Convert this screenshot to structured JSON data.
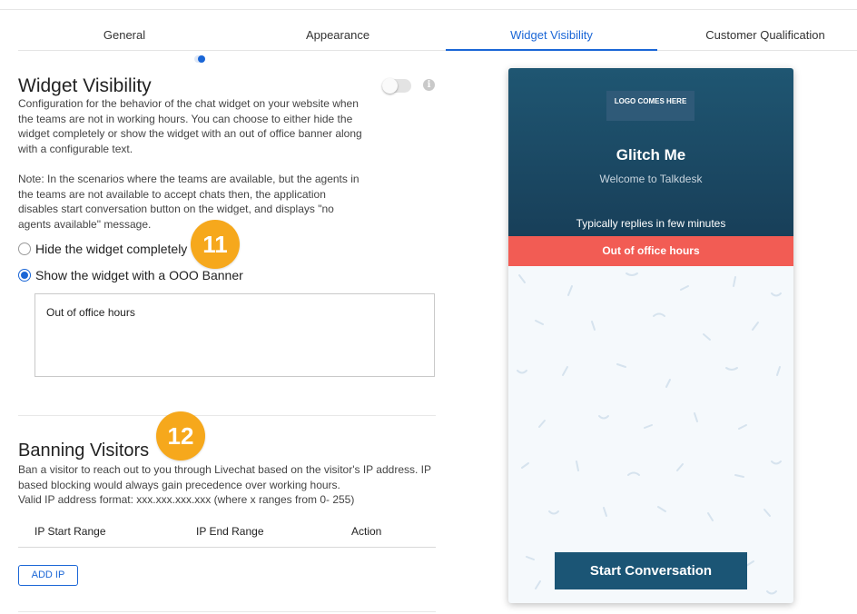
{
  "tabs": [
    {
      "label": "General"
    },
    {
      "label": "Appearance"
    },
    {
      "label": "Widget Visibility",
      "active": true
    },
    {
      "label": "Customer Qualification"
    }
  ],
  "visibility": {
    "title": "Widget Visibility",
    "description": "Configuration for the behavior of the chat widget on your website when the teams are not in working hours. You can choose to either hide the widget completely or show the widget with an out of office banner along with a configurable text.",
    "note": "Note: In the scenarios where the teams are available, but the agents in the teams are not available to accept chats then, the application disables start conversation button on the widget, and displays \"no agents available\" message.",
    "info_icon": "i",
    "option_hide": "Hide the widget completely",
    "option_show": "Show the widget with a OOO Banner",
    "selected": "show",
    "ooo_text": "Out of office hours"
  },
  "badges": {
    "first": "11",
    "second": "12"
  },
  "banning": {
    "title": "Banning Visitors",
    "description": "Ban a visitor to reach out to you through Livechat based on the visitor's IP address. IP based blocking would always gain precedence over working hours.",
    "format": "Valid IP address format: xxx.xxx.xxx.xxx (where x ranges from 0- 255)",
    "columns": [
      "IP Start Range",
      "IP End Range",
      "Action"
    ],
    "add_label": "ADD IP"
  },
  "widget": {
    "logo_text": "LOGO COMES HERE",
    "title": "Glitch Me",
    "subtitle": "Welcome to Talkdesk",
    "replies": "Typically replies in few minutes",
    "banner": "Out of office hours",
    "start_button": "Start Conversation",
    "colors": {
      "header": "#1f5672",
      "banner": "#f25c54",
      "button": "#1b5575"
    }
  },
  "accent_color": "#1a66d6",
  "badge_color": "#f6a81c"
}
